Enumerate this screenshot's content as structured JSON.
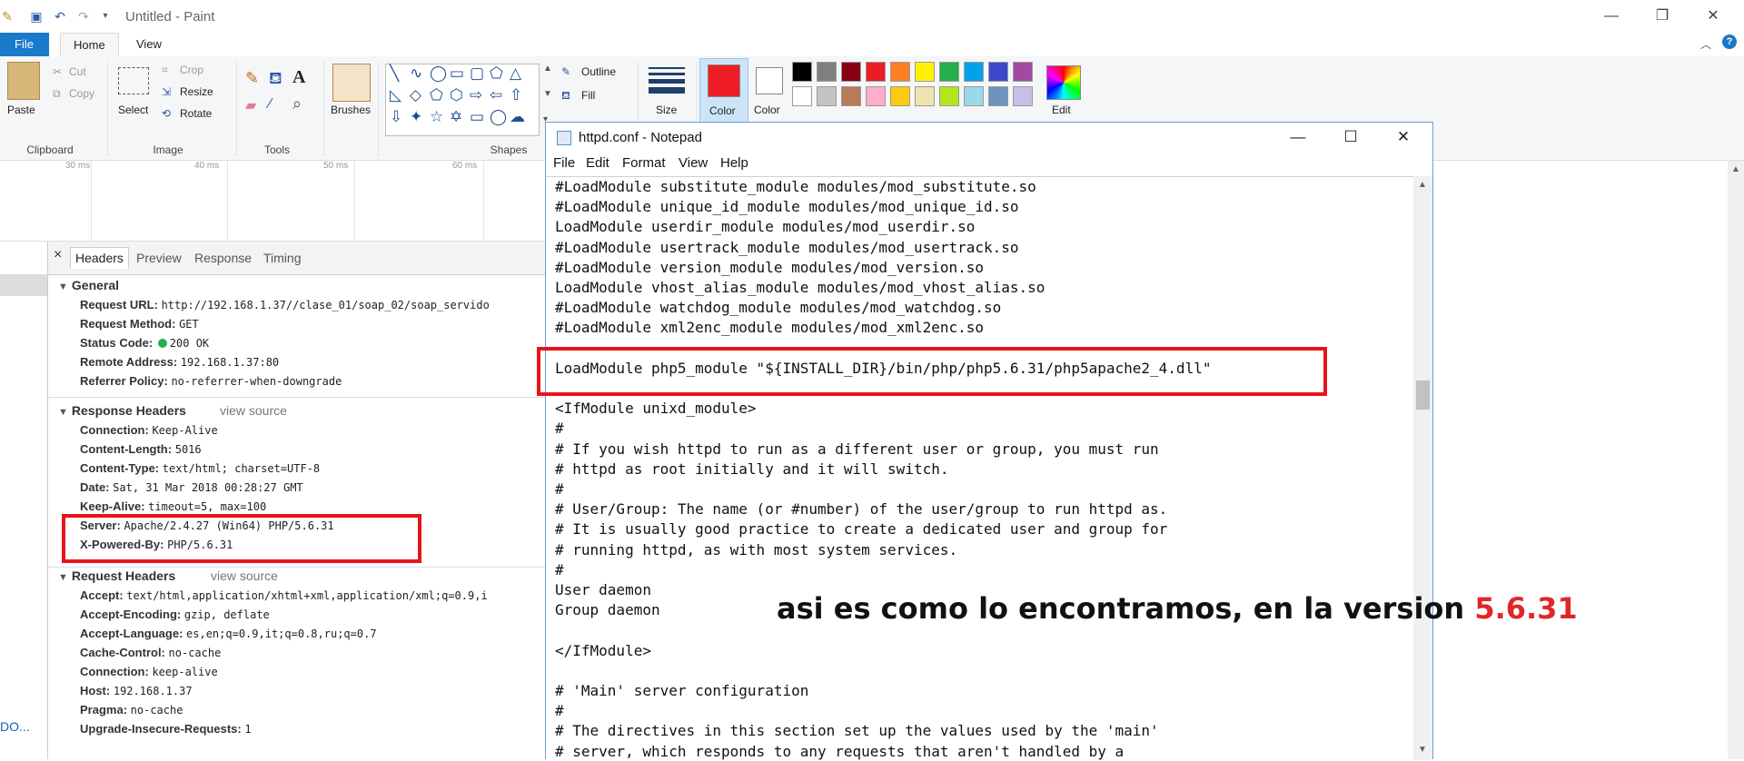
{
  "paint": {
    "title": "Untitled - Paint",
    "tabs": {
      "file": "File",
      "home": "Home",
      "view": "View"
    },
    "clipboard": {
      "paste": "Paste",
      "cut": "Cut",
      "copy": "Copy",
      "group": "Clipboard"
    },
    "image": {
      "select": "Select",
      "crop": "Crop",
      "resize": "Resize",
      "rotate": "Rotate",
      "group": "Image"
    },
    "tools": {
      "group": "Tools"
    },
    "brushes": {
      "label": "Brushes"
    },
    "shapes": {
      "outline": "Outline",
      "fill": "Fill",
      "group": "Shapes"
    },
    "size": {
      "label": "Size"
    },
    "colors": {
      "color1": "Color",
      "color2": "Color",
      "edit": "Edit",
      "primary": "#ee1c24",
      "palette_row1": [
        "#000000",
        "#7f7f7f",
        "#880015",
        "#ed1c24",
        "#ff7f27",
        "#fff200",
        "#22b14c",
        "#00a2e8",
        "#3f48cc",
        "#a349a4"
      ],
      "palette_row2": [
        "#ffffff",
        "#c3c3c3",
        "#b97a57",
        "#ffaec9",
        "#ffc90e",
        "#efe4b0",
        "#b5e61d",
        "#99d9ea",
        "#7092be",
        "#c8bfe7"
      ]
    }
  },
  "devtools": {
    "timeline": [
      "30 ms",
      "40 ms",
      "50 ms",
      "60 ms"
    ],
    "tabs": {
      "close": "×",
      "headers": "Headers",
      "preview": "Preview",
      "response": "Response",
      "timing": "Timing"
    },
    "general": {
      "title": "General",
      "rows": [
        {
          "k": "Request URL:",
          "v": "http://192.168.1.37//clase_01/soap_02/soap_servido"
        },
        {
          "k": "Request Method:",
          "v": "GET"
        },
        {
          "k": "Status Code:",
          "v": "200 OK"
        },
        {
          "k": "Remote Address:",
          "v": "192.168.1.37:80"
        },
        {
          "k": "Referrer Policy:",
          "v": "no-referrer-when-downgrade"
        }
      ]
    },
    "response_headers": {
      "title": "Response Headers",
      "view_source": "view source",
      "rows": [
        {
          "k": "Connection:",
          "v": "Keep-Alive"
        },
        {
          "k": "Content-Length:",
          "v": "5016"
        },
        {
          "k": "Content-Type:",
          "v": "text/html; charset=UTF-8"
        },
        {
          "k": "Date:",
          "v": "Sat, 31 Mar 2018 00:28:27 GMT"
        },
        {
          "k": "Keep-Alive:",
          "v": "timeout=5, max=100"
        },
        {
          "k": "Server:",
          "v": "Apache/2.4.27 (Win64) PHP/5.6.31"
        },
        {
          "k": "X-Powered-By:",
          "v": "PHP/5.6.31"
        }
      ]
    },
    "request_headers": {
      "title": "Request Headers",
      "view_source": "view source",
      "rows": [
        {
          "k": "Accept:",
          "v": "text/html,application/xhtml+xml,application/xml;q=0.9,i"
        },
        {
          "k": "Accept-Encoding:",
          "v": "gzip, deflate"
        },
        {
          "k": "Accept-Language:",
          "v": "es,en;q=0.9,it;q=0.8,ru;q=0.7"
        },
        {
          "k": "Cache-Control:",
          "v": "no-cache"
        },
        {
          "k": "Connection:",
          "v": "keep-alive"
        },
        {
          "k": "Host:",
          "v": "192.168.1.37"
        },
        {
          "k": "Pragma:",
          "v": "no-cache"
        },
        {
          "k": "Upgrade-Insecure-Requests:",
          "v": "1"
        }
      ]
    },
    "bottom_link": "DO..."
  },
  "notepad": {
    "title": "httpd.conf - Notepad",
    "menu": [
      "File",
      "Edit",
      "Format",
      "View",
      "Help"
    ],
    "lines": [
      "#LoadModule substitute_module modules/mod_substitute.so",
      "#LoadModule unique_id_module modules/mod_unique_id.so",
      "LoadModule userdir_module modules/mod_userdir.so",
      "#LoadModule usertrack_module modules/mod_usertrack.so",
      "#LoadModule version_module modules/mod_version.so",
      "LoadModule vhost_alias_module modules/mod_vhost_alias.so",
      "#LoadModule watchdog_module modules/mod_watchdog.so",
      "#LoadModule xml2enc_module modules/mod_xml2enc.so",
      "",
      "LoadModule php5_module \"${INSTALL_DIR}/bin/php/php5.6.31/php5apache2_4.dll\"",
      "",
      "<IfModule unixd_module>",
      "#",
      "# If you wish httpd to run as a different user or group, you must run",
      "# httpd as root initially and it will switch.",
      "#",
      "# User/Group: The name (or #number) of the user/group to run httpd as.",
      "# It is usually good practice to create a dedicated user and group for",
      "# running httpd, as with most system services.",
      "#",
      "User daemon",
      "Group daemon",
      "",
      "</IfModule>",
      "",
      "# 'Main' server configuration",
      "#",
      "# The directives in this section set up the values used by the 'main'",
      "# server, which responds to any requests that aren't handled by a"
    ]
  },
  "caption": {
    "text": "asi es como lo encontramos, en la version ",
    "version": "5.6.31"
  }
}
